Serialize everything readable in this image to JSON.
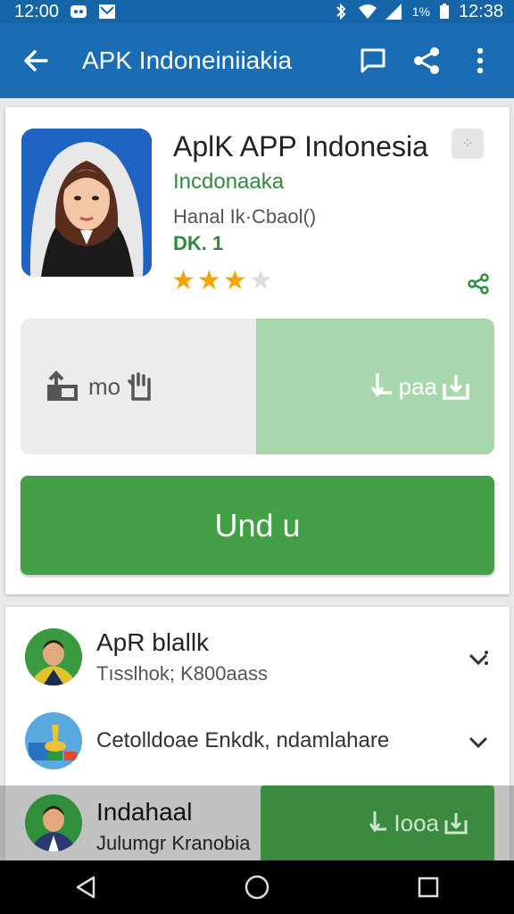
{
  "status_bar": {
    "time_left": "12:00",
    "time_right": "12:38",
    "percent": "1%"
  },
  "app_bar": {
    "title": "APK Indoneiniiakia",
    "icons": [
      "back-arrow-icon",
      "message-icon",
      "share-icon",
      "more-vert-icon"
    ]
  },
  "app_card": {
    "name": "AplK APP Indonesia",
    "developer": "Incdonaaka",
    "meta": "Hanal Ik·Cbaol()",
    "size": "DK. 1",
    "rating_stars": 3,
    "rating_max": 5,
    "split_left_label": "mo",
    "split_right_label": "paa",
    "install_label": "Und u",
    "accent_color": "#43a047",
    "appbar_color": "#1a6cb3"
  },
  "list": {
    "items": [
      {
        "title": "ApR blallk",
        "subtitle": "Tısslhok; K800aass"
      },
      {
        "title": "Cetolldoae Enkdk, ndamlahare"
      },
      {
        "title": "Indahaal",
        "subtitle": "Julumgr Kranobia",
        "button_label": "Iooa"
      }
    ]
  }
}
